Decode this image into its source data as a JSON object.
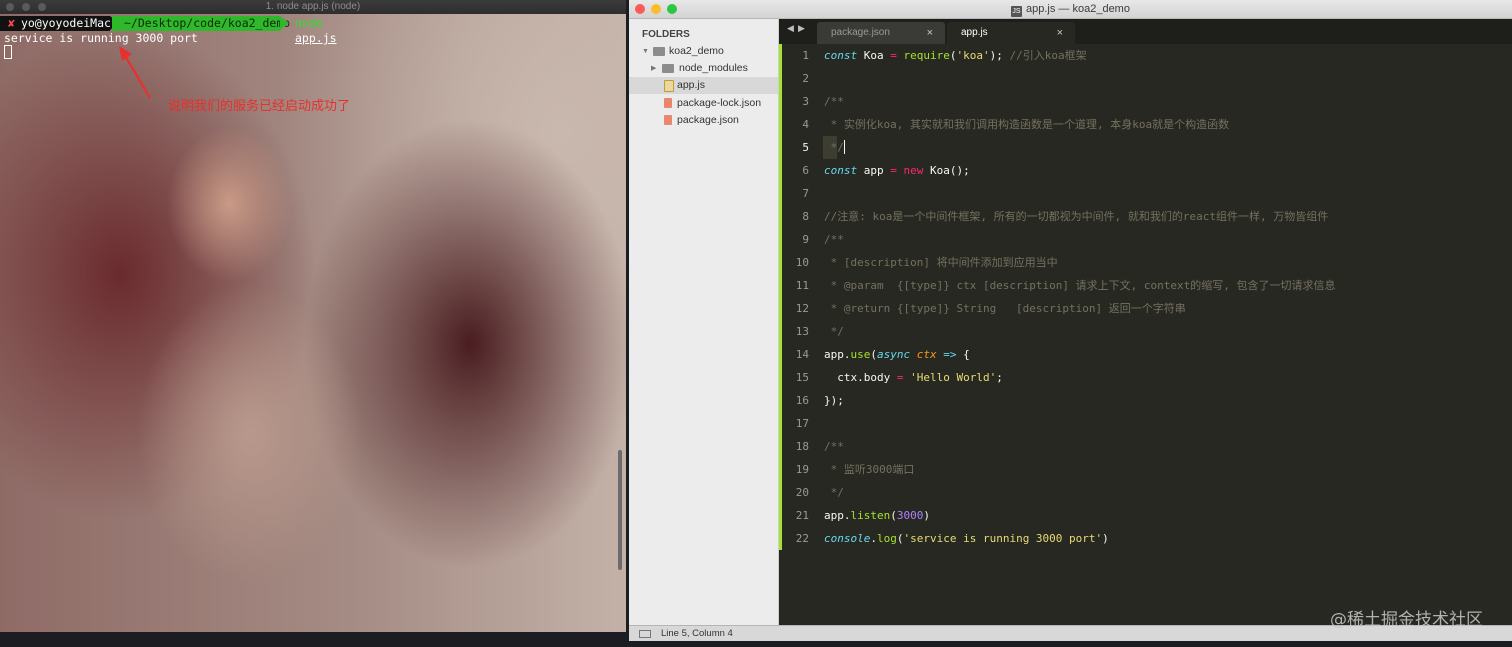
{
  "terminal": {
    "title": "1. node app.js (node)",
    "prompt_user": "yo@yoyodeiMac",
    "prompt_error_mark": "✘",
    "prompt_path": "~/Desktop/code/koa2_demo",
    "command": "node",
    "command_arg": "app.js",
    "output_line": "service is running 3000 port",
    "annotation": "说明我们的服务已经启动成功了"
  },
  "editor_window": {
    "title": "app.js — koa2_demo",
    "title_icon": "document-icon",
    "sidebar": {
      "header": "FOLDERS",
      "items": [
        {
          "label": "koa2_demo",
          "type": "folder",
          "expanded": true
        },
        {
          "label": "node_modules",
          "type": "folder",
          "expanded": false
        },
        {
          "label": "app.js",
          "type": "file",
          "selected": true
        },
        {
          "label": "package-lock.json",
          "type": "file"
        },
        {
          "label": "package.json",
          "type": "file"
        }
      ]
    },
    "tabs": [
      {
        "label": "package.json",
        "active": false,
        "close": "×"
      },
      {
        "label": "app.js",
        "active": true,
        "close": "×"
      }
    ],
    "nav": {
      "back": "◀",
      "forward": "▶"
    },
    "line_numbers": [
      "1",
      "2",
      "3",
      "4",
      "5",
      "6",
      "7",
      "8",
      "9",
      "10",
      "11",
      "12",
      "13",
      "14",
      "15",
      "16",
      "17",
      "18",
      "19",
      "20",
      "21",
      "22"
    ],
    "current_line": 5,
    "code": {
      "l1_kw": "const",
      "l1_name": " Koa ",
      "l1_eq": "=",
      "l1_fn": " require",
      "l1_open": "(",
      "l1_str": "'koa'",
      "l1_close": ");",
      "l1_comment": " //引入koa框架",
      "l3": "/**",
      "l4": " * 实例化koa, 其实就和我们调用构造函数是一个道理, 本身koa就是个构造函数",
      "l5": " */",
      "l6_kw": "const",
      "l6_name": " app ",
      "l6_eq": "=",
      "l6_new": " new",
      "l6_call": " Koa",
      "l6_end": "();",
      "l8": "//注意: koa是一个中间件框架, 所有的一切都视为中间件, 就和我们的react组件一样, 万物皆组件",
      "l9": "/**",
      "l10": " * [description] 将中间件添加到应用当中",
      "l11": " * @param  {[type]} ctx [description] 请求上下文, context的缩写, 包含了一切请求信息",
      "l12": " * @return {[type]} String   [description] 返回一个字符串",
      "l13": " */",
      "l14_obj": "app",
      "l14_dot": ".",
      "l14_fn": "use",
      "l14_open": "(",
      "l14_async": "async",
      "l14_sp": " ",
      "l14_param": "ctx",
      "l14_arrow": " =>",
      "l14_end": " {",
      "l15_pre": "  ctx",
      "l15_dot": ".",
      "l15_prop": "body ",
      "l15_eq": "=",
      "l15_str": " 'Hello World'",
      "l15_end": ";",
      "l16": "});",
      "l18": "/**",
      "l19": " * 监听3000端口",
      "l20": " */",
      "l21_obj": "app",
      "l21_dot": ".",
      "l21_fn": "listen",
      "l21_open": "(",
      "l21_num": "3000",
      "l21_close": ")",
      "l22_obj": "console",
      "l22_dot": ".",
      "l22_fn": "log",
      "l22_open": "(",
      "l22_str": "'service is running 3000 port'",
      "l22_close": ")"
    },
    "status": "Line 5, Column 4"
  },
  "watermark": "@稀土掘金技术社区",
  "colors": {
    "monokai_bg": "#272822",
    "keyword": "#66d9ef",
    "string": "#e6db74",
    "comment": "#75715e",
    "number": "#ae81ff",
    "operator": "#f92672",
    "function": "#a6e22e",
    "annotation_red": "#e8302c",
    "prompt_green": "#2fb82a"
  }
}
